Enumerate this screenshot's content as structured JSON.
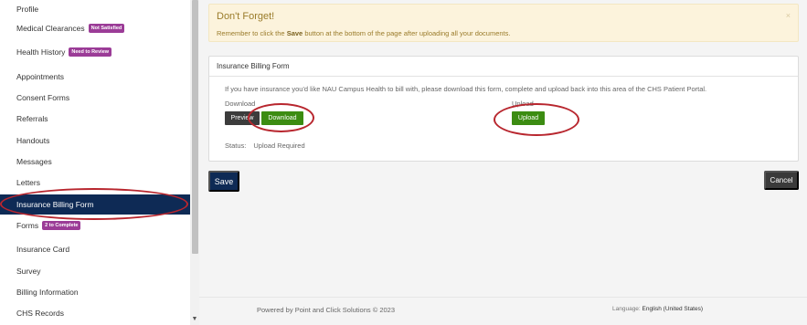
{
  "sidebar": {
    "items": [
      {
        "label": "Profile",
        "badge": ""
      },
      {
        "label": "Medical Clearances",
        "badge": "Not Satisfied"
      },
      {
        "label": "Health History",
        "badge": "Need to Review"
      },
      {
        "label": "Appointments",
        "badge": ""
      },
      {
        "label": "Consent Forms",
        "badge": ""
      },
      {
        "label": "Referrals",
        "badge": ""
      },
      {
        "label": "Handouts",
        "badge": ""
      },
      {
        "label": "Messages",
        "badge": ""
      },
      {
        "label": "Letters",
        "badge": ""
      },
      {
        "label": "Insurance Billing Form",
        "badge": "",
        "active": true
      },
      {
        "label": "Forms",
        "badge": "2 to Complete"
      },
      {
        "label": "Insurance Card",
        "badge": ""
      },
      {
        "label": "Survey",
        "badge": ""
      },
      {
        "label": "Billing Information",
        "badge": ""
      },
      {
        "label": "CHS Records",
        "badge": ""
      }
    ],
    "scroll_down_glyph": "▼"
  },
  "alert": {
    "title": "Don't Forget!",
    "text_before": "Remember to click the ",
    "text_bold": "Save",
    "text_after": " button at the bottom of the page after uploading all your documents.",
    "close": "×"
  },
  "card": {
    "header": "Insurance Billing Form",
    "intro": "If you have insurance you'd like NAU Campus Health to bill with, please download this form, complete and upload back into this area of the CHS Patient Portal.",
    "download_label": "Download",
    "upload_label": "Upload",
    "preview_button": "Preview",
    "download_button": "Download",
    "upload_button": "Upload",
    "status_label": "Status:",
    "status_value": "Upload Required"
  },
  "actions": {
    "save": "Save",
    "cancel": "Cancel"
  },
  "footer": {
    "powered": "Powered by Point and Click Solutions © 2023",
    "language_label": "Language:",
    "language_value": "English (United States)"
  },
  "colors": {
    "nav_active": "#0e2a55",
    "badge": "#9b3c97",
    "green_button": "#3c8c12",
    "annotation_circle": "#b8262e",
    "alert_bg": "#fcf3dc"
  }
}
